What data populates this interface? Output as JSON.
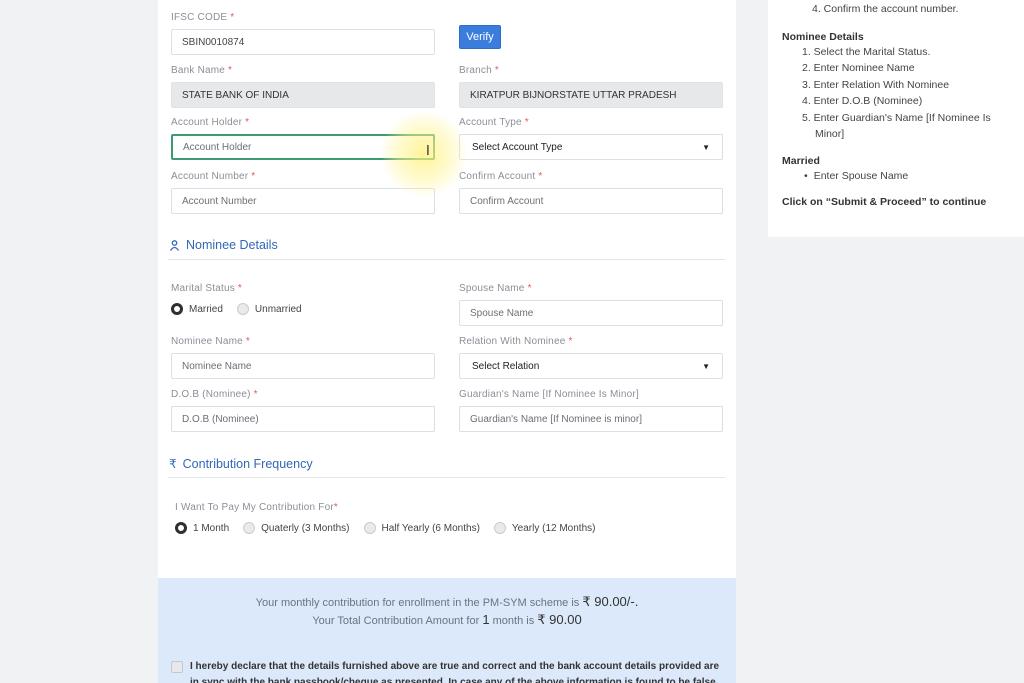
{
  "bank": {
    "ifsc_label": "IFSC CODE",
    "ifsc_value": "SBIN0010874",
    "verify_label": "Verify",
    "bank_name_label": "Bank Name",
    "bank_name_value": "STATE BANK OF INDIA",
    "branch_label": "Branch",
    "branch_value": "KIRATPUR BIJNORSTATE UTTAR PRADESH",
    "account_holder_label": "Account Holder",
    "account_holder_placeholder": "Account Holder",
    "account_type_label": "Account Type",
    "account_type_selected": "Select Account Type",
    "account_number_label": "Account Number",
    "account_number_placeholder": "Account Number",
    "confirm_account_label": "Confirm Account",
    "confirm_account_placeholder": "Confirm Account",
    "required_mark": "*"
  },
  "nominee": {
    "section_title": "Nominee Details",
    "marital_status_label": "Marital Status",
    "married_label": "Married",
    "unmarried_label": "Unmarried",
    "spouse_name_label": "Spouse Name",
    "spouse_name_placeholder": "Spouse Name",
    "nominee_name_label": "Nominee Name",
    "nominee_name_placeholder": "Nominee Name",
    "relation_label": "Relation With Nominee",
    "relation_selected": "Select Relation",
    "dob_label": "D.O.B (Nominee)",
    "dob_placeholder": "D.O.B (Nominee)",
    "guardian_label": "Guardian's Name [If Nominee Is Minor]",
    "guardian_placeholder": "Guardian's Name [If Nominee is minor]"
  },
  "contribution": {
    "section_title": "Contribution Frequency",
    "question_label": "I Want To Pay My Contribution For",
    "options": [
      "1 Month",
      "Quaterly (3 Months)",
      "Half Yearly (6 Months)",
      "Yearly (12 Months)"
    ],
    "monthly_text": "Your monthly contribution for enrollment in the PM-SYM scheme is",
    "monthly_amount": "₹ 90.00/-.",
    "total_text_a": "Your Total Contribution Amount for",
    "total_months": "1",
    "total_text_b": "month is",
    "total_amount": "₹ 90.00",
    "declaration": "I hereby declare that the details furnished above are true and correct and the bank account details provided are in sync with the bank passbook/cheque as presented. In case any of the above information is found to be false or"
  },
  "sidebar": {
    "top_item": "4. Confirm the account number.",
    "nominee_heading": "Nominee Details",
    "nominee_steps": [
      "1. Select the Marital Status.",
      "2. Enter Nominee Name",
      "3. Enter Relation With Nominee",
      "4. Enter D.O.B (Nominee)",
      "5. Enter Guardian's Name [If Nominee Is",
      "Minor]"
    ],
    "married_heading": "Married",
    "married_steps": [
      "Enter Spouse Name"
    ],
    "footer": "Click on “Submit & Proceed” to continue"
  },
  "icons": {
    "nominee_icon": "person-icon",
    "contribution_icon": "rupee-icon"
  },
  "colors": {
    "accent": "#3b7ddd",
    "section_title": "#3266b8",
    "info_bg": "#dbe9fb",
    "active_border": "#3e9a70"
  }
}
